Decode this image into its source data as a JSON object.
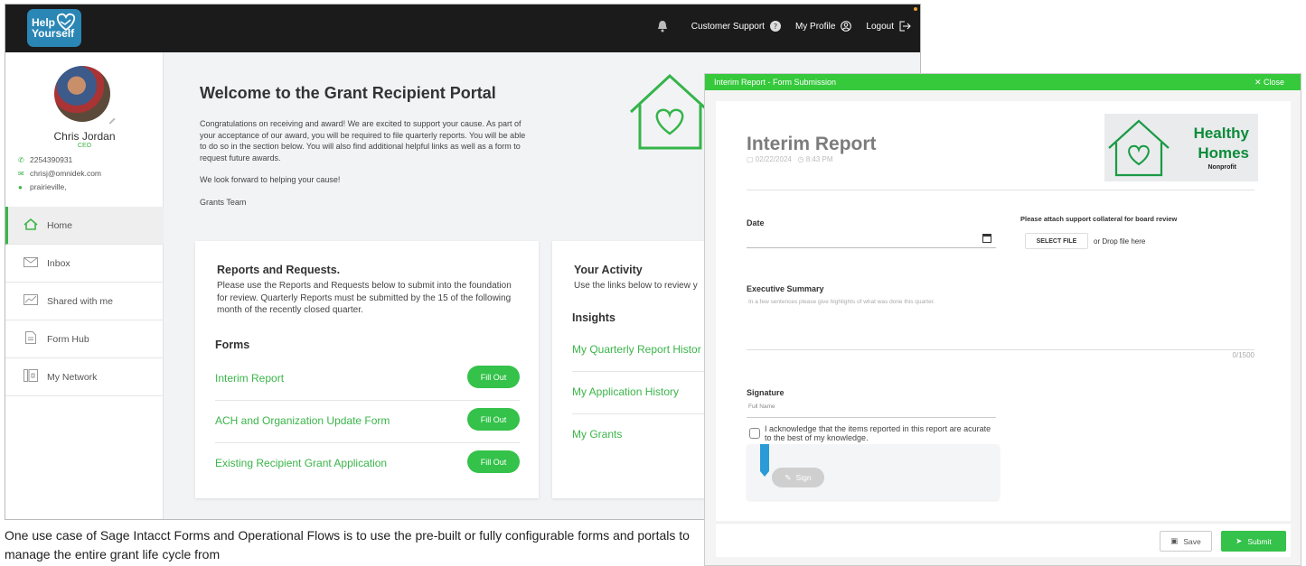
{
  "brand": {
    "logo_line1": "Help",
    "logo_line2": "Yourself",
    "accent": "#3bb54a",
    "header_bg": "#1b1b1b"
  },
  "topnav": {
    "support": "Customer Support",
    "profile": "My Profile",
    "logout": "Logout"
  },
  "user": {
    "name": "Chris Jordan",
    "role": "CEO",
    "phone": "2254390931",
    "email": "chrisj@omnidek.com",
    "location": "prairieville,"
  },
  "sidebar": {
    "items": [
      {
        "label": "Home",
        "icon": "home-icon",
        "active": true
      },
      {
        "label": "Inbox",
        "icon": "mail-icon",
        "active": false
      },
      {
        "label": "Shared with me",
        "icon": "chart-icon",
        "active": false
      },
      {
        "label": "Form Hub",
        "icon": "document-icon",
        "active": false
      },
      {
        "label": "My Network",
        "icon": "network-icon",
        "active": false
      }
    ]
  },
  "main": {
    "title": "Welcome to the Grant Recipient Portal",
    "para1": "Congratulations on receiving and award! We are excited to support your cause. As part of your acceptance of our award, you will be required to file quarterly reports. You will be able to do so in the section below. You will also find additional helpful links as well as a form to request future awards.",
    "para2": "We look forward to helping your cause!",
    "para3": "Grants Team"
  },
  "reports_card": {
    "title": "Reports and Requests.",
    "desc": "Please use the Reports and Requests below to submit into the foundation for review. Quarterly Reports must be submitted by the 15 of the following month of the recently closed quarter.",
    "forms_heading": "Forms",
    "forms": [
      {
        "label": "Interim Report",
        "button": "Fill Out"
      },
      {
        "label": "ACH and Organization Update Form",
        "button": "Fill Out"
      },
      {
        "label": "Existing Recipient Grant Application",
        "button": "Fill Out"
      }
    ]
  },
  "activity_card": {
    "title": "Your Activity",
    "desc": "Use the links below to review y",
    "insights_heading": "Insights",
    "links": [
      "My Quarterly Report Histor",
      "My Application History",
      "My Grants"
    ]
  },
  "caption": "One use case of Sage Intacct Forms and Operational Flows is to use the pre-built or fully configurable forms and portals to manage the entire grant life cycle from",
  "modal": {
    "header_title": "Interim Report - Form Submission",
    "close_label": "✕ Close",
    "report_title": "Interim Report",
    "date_meta": "02/22/2024",
    "time_meta": "8:43 PM",
    "logo": {
      "line1": "Healthy",
      "line2": "Homes",
      "line3": "Nonprofit"
    },
    "date_label": "Date",
    "attach_label": "Please attach support collateral for board review",
    "select_file": "SELECT FILE",
    "drop_text": "or Drop file here",
    "exec_label": "Executive Summary",
    "exec_placeholder": "In a few sentences please give highlights of what was done this quarter.",
    "counter": "0/1500",
    "signature_label": "Signature",
    "fullname_placeholder": "Full Name",
    "ack_text": "I acknowledge that the items reported in this report are acurate to the best of my knowledge.",
    "sign_button": "Sign",
    "save_button": "Save",
    "submit_button": "Submit"
  }
}
